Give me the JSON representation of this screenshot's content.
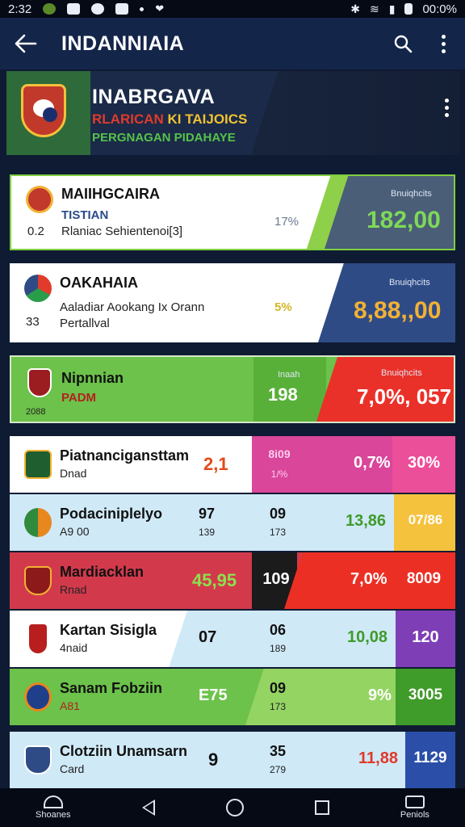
{
  "status_bar": {
    "time": "2:32",
    "clock_right": "00:0%",
    "icons_left": [
      "whatsapp-icon",
      "photo-icon",
      "settings-icon",
      "app-icon",
      "dot-icon",
      "heart-icon"
    ],
    "icons_right": [
      "bluetooth-icon",
      "wifi-icon",
      "signal-icon",
      "battery-icon"
    ]
  },
  "app_bar": {
    "title": "INDANNIAIA"
  },
  "banner": {
    "title": "INABRGAVA",
    "line1_a": "RLARICAN",
    "line1_b": "KI TAIJOICS",
    "line2": "PERGNAGAN PIDAHAYE"
  },
  "cards": [
    {
      "name": "MAIIHGCAIRA",
      "tag": "TISTIAN",
      "rank": "0.2",
      "desc": "Rlaniac Sehientenoi[3]",
      "pct": "17%",
      "label": "Bnuiqhcits",
      "value": "182,00",
      "panel_color": "#4a5e78",
      "value_color": "#7ed957",
      "accent": "#8ed04a"
    },
    {
      "name": "OAKAHAIA",
      "tag": "",
      "rank": "33",
      "desc": "Aaladiar Aookang Ix Orann",
      "desc2": "Pertallval",
      "pct": "5%",
      "label": "Bnuiqhcits",
      "value": "8,88,,00",
      "panel_color": "#2f4b86",
      "value_color": "#f2b134",
      "accent": "#2f4b86"
    },
    {
      "name": "Nipnnian",
      "tag": "PADM",
      "rank": "2088",
      "desc": "",
      "pct": "",
      "label": "Bnuiqhcits",
      "label_mid": "Inaah",
      "mid_value": "198",
      "value": "7,0%, 057",
      "panel_color": "#ea3129",
      "value_color": "#ffffff",
      "accent": "#6cc24a"
    }
  ],
  "rows": [
    {
      "name": "Piatnancigansttam",
      "sub": "Dnad",
      "c1": "2,1",
      "c2": "8i09",
      "c2s": "1/%",
      "c3": "0,7%",
      "c4": "30%"
    },
    {
      "name": "Podaciniplelyo",
      "sub": "A9 00",
      "c1": "97",
      "c1s": "139",
      "c2": "09",
      "c2s": "173",
      "c3": "13,86",
      "c4": "07/86"
    },
    {
      "name": "Mardiacklan",
      "sub": "Rnad",
      "c1": "45,95",
      "c2": "109",
      "c2s": "",
      "c3": "7,0%",
      "c4": "8009"
    },
    {
      "name": "Kartan Sisigla",
      "sub": "4naid",
      "c1": "07",
      "c2": "06",
      "c2s": "189",
      "c3": "10,08",
      "c4": "120"
    },
    {
      "name": "Sanam Fobziin",
      "sub": "A81",
      "c1": "E75",
      "c2": "09",
      "c2s": "173",
      "c3": "9%",
      "c4": "3005"
    },
    {
      "name": "Clotziin Unamsarn",
      "sub": "Card",
      "c1": "9",
      "c2": "35",
      "c2s": "279",
      "c3": "11,88",
      "c4": "1129"
    }
  ],
  "nav": {
    "left_label": "Shoanes",
    "right_label": "Peniols"
  }
}
